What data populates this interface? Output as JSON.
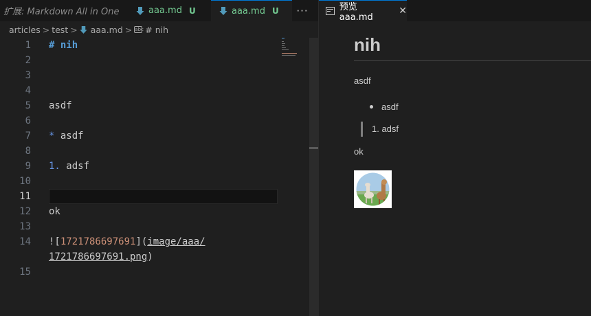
{
  "left": {
    "tabs": [
      {
        "label": "扩展: Markdown All in One"
      },
      {
        "label": "aaa.md",
        "status": "U"
      },
      {
        "label": "aaa.md",
        "status": "U"
      }
    ],
    "more_label": "···",
    "breadcrumb": [
      "articles",
      "test",
      "aaa.md",
      "# nih"
    ],
    "separator": ">",
    "lines": [
      {
        "n": "1",
        "text": "# nih"
      },
      {
        "n": "2",
        "text": ""
      },
      {
        "n": "3",
        "text": ""
      },
      {
        "n": "4",
        "text": ""
      },
      {
        "n": "5",
        "text": "asdf"
      },
      {
        "n": "6",
        "text": ""
      },
      {
        "n": "7",
        "mark": "*",
        "text": " asdf"
      },
      {
        "n": "8",
        "text": ""
      },
      {
        "n": "9",
        "mark": "1.",
        "text": " adsf"
      },
      {
        "n": "10",
        "text": ""
      },
      {
        "n": "11",
        "text": ""
      },
      {
        "n": "12",
        "text": "ok"
      },
      {
        "n": "13",
        "text": ""
      },
      {
        "n": "14",
        "prefix": "![",
        "num": "1721786697691",
        "mid": "](",
        "url": "image/aaa/",
        "url2": "1721786697691.png",
        "suffix": ")"
      },
      {
        "n": "15",
        "text": ""
      }
    ],
    "colors": {
      "accent": "#0078d4",
      "untracked": "#73c991",
      "heading": "#569cd6",
      "link_text": "#ce9178"
    }
  },
  "right": {
    "tab": {
      "label": "预览 aaa.md",
      "close": "✕"
    },
    "preview": {
      "h1": "nih",
      "p1": "asdf",
      "list_item": "asdf",
      "ordered_item": "1. adsf",
      "p2": "ok",
      "image_icon": "alpaca-image"
    }
  }
}
